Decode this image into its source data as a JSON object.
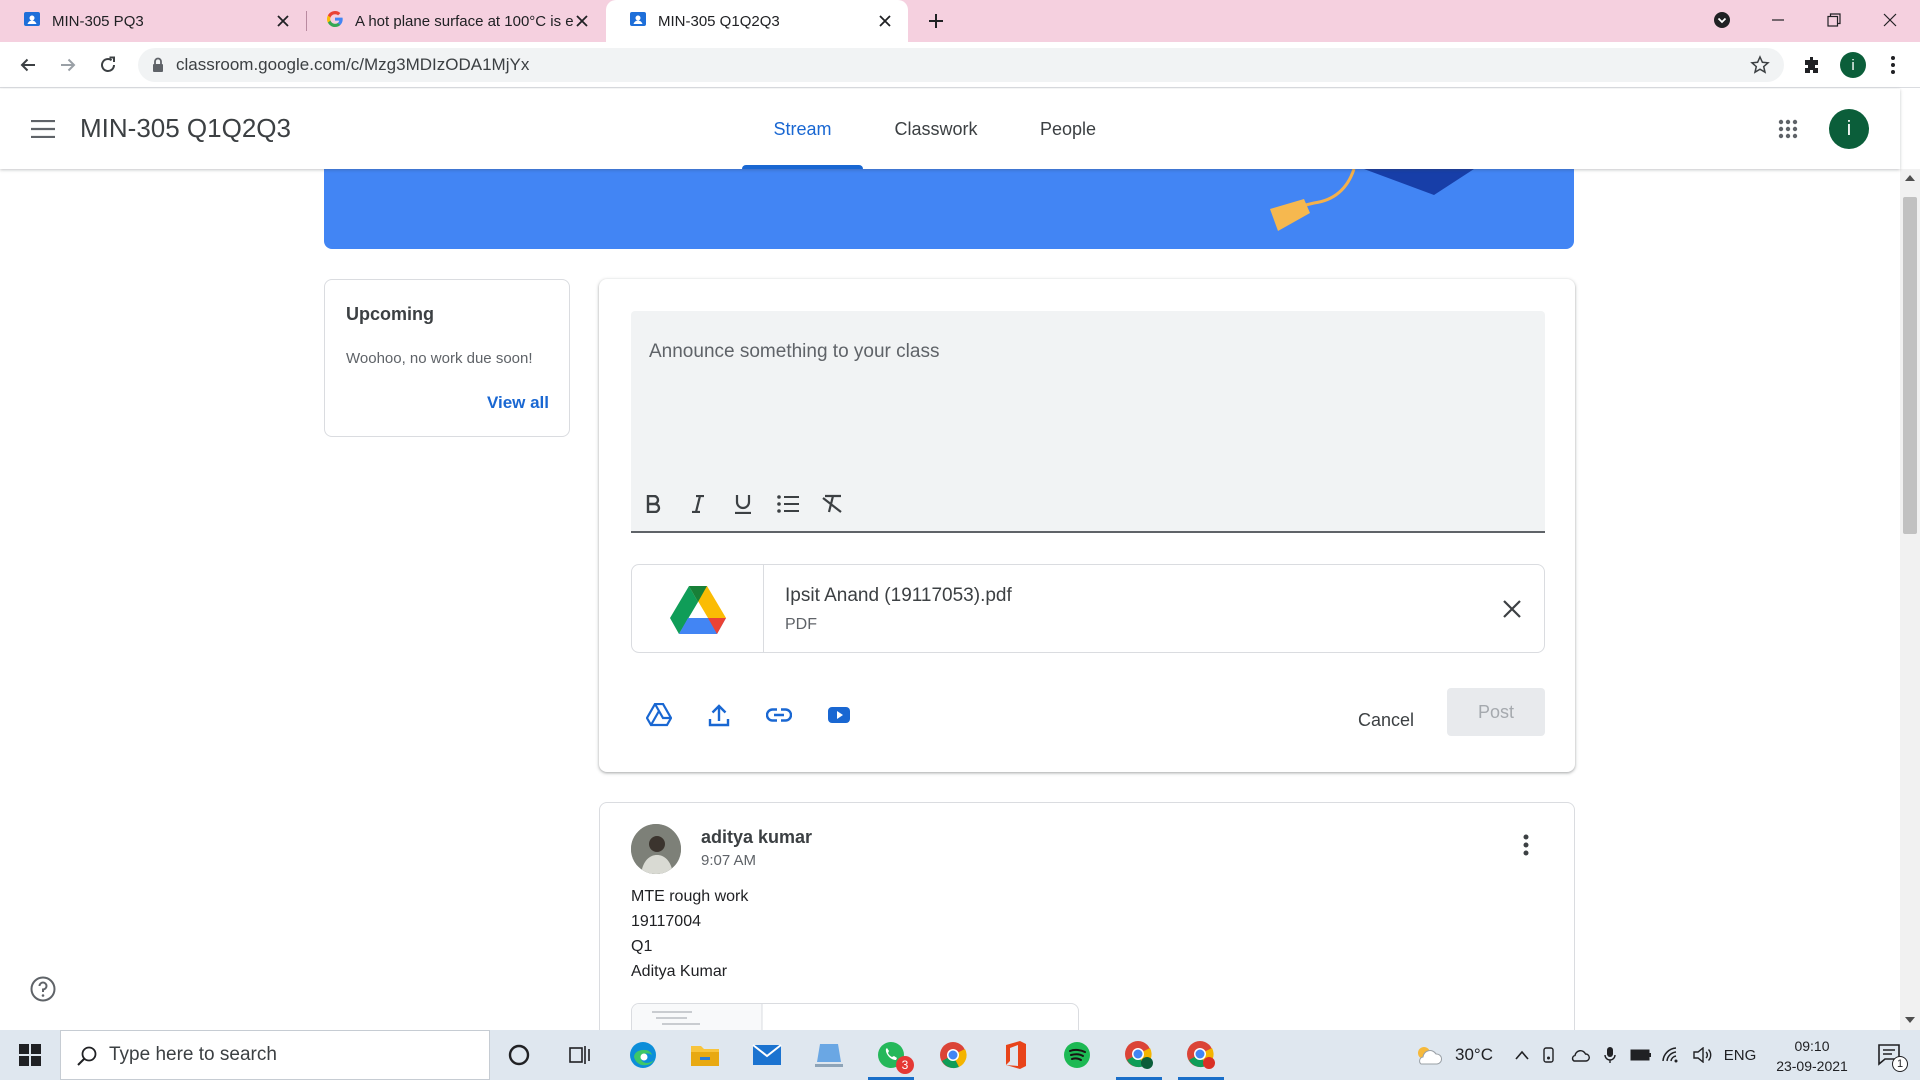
{
  "browser": {
    "tabs": [
      {
        "title": "MIN-305 PQ3",
        "active": false
      },
      {
        "title": "A hot plane surface at 100°C is e",
        "active": false
      },
      {
        "title": "MIN-305 Q1Q2Q3",
        "active": true
      }
    ],
    "url": "classroom.google.com/c/Mzg3MDIzODA1MjYx",
    "profile_initial": "i"
  },
  "header": {
    "class_title": "MIN-305 Q1Q2Q3",
    "tabs": [
      "Stream",
      "Classwork",
      "People"
    ],
    "active_tab": "Stream",
    "avatar_initial": "i"
  },
  "upcoming": {
    "heading": "Upcoming",
    "message": "Woohoo, no work due soon!",
    "view_all": "View all"
  },
  "compose": {
    "placeholder": "Announce something to your class",
    "attachment": {
      "name": "Ipsit Anand (19117053).pdf",
      "type": "PDF"
    },
    "cancel_label": "Cancel",
    "post_label": "Post"
  },
  "post": {
    "author": "aditya kumar",
    "time": "9:07 AM",
    "lines": [
      "MTE rough work",
      "19117004",
      "Q1",
      "Aditya Kumar"
    ]
  },
  "taskbar": {
    "search_placeholder": "Type here to search",
    "whatsapp_badge": "3",
    "temperature": "30°C",
    "language": "ENG",
    "time": "09:10",
    "date": "23-09-2021",
    "notification_count": "1"
  },
  "colors": {
    "accent": "#1967d2",
    "banner": "#4285f4",
    "tabstrip": "#f5d0df",
    "avatar": "#0b5e3a"
  }
}
